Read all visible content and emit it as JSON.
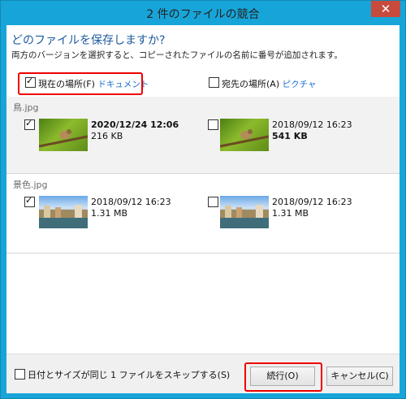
{
  "window": {
    "title": "2 件のファイルの競合",
    "close_glyph": "✕"
  },
  "header": {
    "question": "どのファイルを保存しますか?",
    "description": "両方のバージョンを選択すると、コピーされたファイルの名前に番号が追加されます。"
  },
  "columns": {
    "current": {
      "label": "現在の場所(F)",
      "link": "ドキュメント",
      "checked": true
    },
    "destination": {
      "label": "宛先の場所(A)",
      "link": "ピクチャ",
      "checked": false
    }
  },
  "files": [
    {
      "name": "鳥.jpg",
      "current": {
        "checked": true,
        "date": "2020/12/24 12:06",
        "size": "216 KB"
      },
      "destination": {
        "checked": false,
        "date": "2018/09/12 16:23",
        "size": "541 KB"
      }
    },
    {
      "name": "景色.jpg",
      "current": {
        "checked": true,
        "date": "2018/09/12 16:23",
        "size": "1.31 MB"
      },
      "destination": {
        "checked": false,
        "date": "2018/09/12 16:23",
        "size": "1.31 MB"
      }
    }
  ],
  "footer": {
    "skip_label": "日付とサイズが同じ 1 ファイルをスキップする(S)",
    "continue_label": "続行(O)",
    "cancel_label": "キャンセル(C)"
  },
  "colors": {
    "accent": "#17a5d9",
    "highlight": "#e00000",
    "link": "#1a6fd1"
  }
}
